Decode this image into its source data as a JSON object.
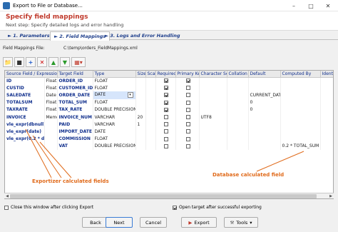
{
  "window": {
    "title": "Export to File or Database..."
  },
  "header": {
    "title": "Specify field mappings",
    "subtitle": "Next step: Specify detailed logs and error handling"
  },
  "tabs": [
    {
      "label": "1. Parameters"
    },
    {
      "label": "2. Field Mappings"
    },
    {
      "label": "3. Logs and Error Handling"
    }
  ],
  "mappings_file": {
    "label": "Field Mappings File:",
    "value": "C:\\temp\\orders_FieldMappings.xml"
  },
  "grid": {
    "headers": [
      "Source Field / Expression",
      "Target Field",
      "Type",
      "Size",
      "Scale",
      "Required",
      "Primary Key",
      "Character Set",
      "Collation",
      "Default",
      "Computed By",
      "Identi"
    ],
    "rows": [
      {
        "src": "ID",
        "stype": "Float",
        "tgt": "ORDER_ID",
        "type": "FLOAT",
        "size": "",
        "scale": "",
        "req": true,
        "pk": true,
        "cs": "",
        "coll": "",
        "def": "",
        "comp": ""
      },
      {
        "src": "CUSTID",
        "stype": "Float",
        "tgt": "CUSTOMER_ID",
        "type": "FLOAT",
        "size": "",
        "scale": "",
        "req": true,
        "pk": false,
        "cs": "",
        "coll": "",
        "def": "",
        "comp": ""
      },
      {
        "src": "SALEDATE",
        "stype": "Date",
        "tgt": "ORDER_DATE",
        "type": "DATE",
        "size": "",
        "scale": "",
        "req": true,
        "pk": false,
        "cs": "",
        "coll": "",
        "def": "CURRENT_DATE",
        "comp": ""
      },
      {
        "src": "TOTALSUM",
        "stype": "Float",
        "tgt": "TOTAL_SUM",
        "type": "FLOAT",
        "size": "",
        "scale": "",
        "req": true,
        "pk": false,
        "cs": "",
        "coll": "",
        "def": "0",
        "comp": ""
      },
      {
        "src": "TAXRATE",
        "stype": "Float",
        "tgt": "TAX_RATE",
        "type": "DOUBLE PRECISION",
        "size": "",
        "scale": "",
        "req": true,
        "pk": false,
        "cs": "",
        "coll": "",
        "def": "0",
        "comp": ""
      },
      {
        "src": "INVOICE",
        "stype": "Memo",
        "tgt": "INVOICE_NUM",
        "type": "VARCHAR",
        "size": "20",
        "scale": "",
        "req": false,
        "pk": false,
        "cs": "UTF8",
        "coll": "",
        "def": "",
        "comp": ""
      },
      {
        "src": "vle_expr(dbnull)",
        "stype": "",
        "tgt": "PAID",
        "type": "VARCHAR",
        "size": "1",
        "scale": "",
        "req": false,
        "pk": false,
        "cs": "",
        "coll": "",
        "def": "",
        "comp": ""
      },
      {
        "src": "vle_expr(date)",
        "stype": "",
        "tgt": "IMPORT_DATE",
        "type": "DATE",
        "size": "",
        "scale": "",
        "req": false,
        "pk": false,
        "cs": "",
        "coll": "",
        "def": "",
        "comp": ""
      },
      {
        "src": "vle_expr(0.2 * dataset",
        "stype": "",
        "tgt": "COMMISSION",
        "type": "FLOAT",
        "size": "",
        "scale": "",
        "req": false,
        "pk": false,
        "cs": "",
        "coll": "",
        "def": "",
        "comp": ""
      },
      {
        "src": "",
        "stype": "",
        "tgt": "VAT",
        "type": "DOUBLE PRECISION",
        "size": "",
        "scale": "",
        "req": false,
        "pk": false,
        "cs": "",
        "coll": "",
        "def": "",
        "comp": "0.2 * TOTAL_SUM"
      }
    ]
  },
  "annotations": {
    "left": "Exportizer calculated fields",
    "right": "Database calculated field"
  },
  "options": {
    "close_label": "Close this window after clicking Export",
    "open_label": "Open target after successful exporting"
  },
  "buttons": {
    "back": "Back",
    "next": "Next",
    "cancel": "Cancel",
    "export": "Export",
    "tools": "Tools"
  },
  "colors": {
    "accent": "#c0392b",
    "annotation": "#e06a1a",
    "field_blue": "#0f2e8c"
  }
}
